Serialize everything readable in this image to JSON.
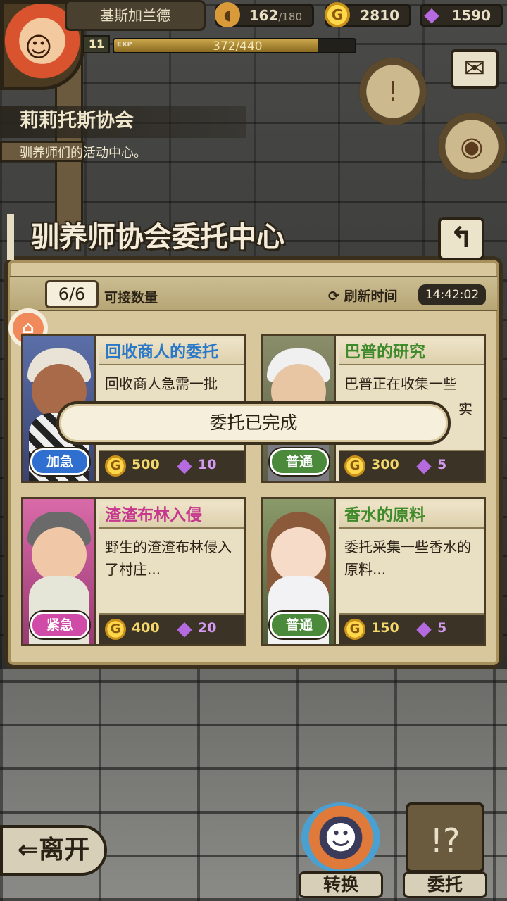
{
  "hud": {
    "player_name": "基斯加兰德",
    "level": "11",
    "exp_label": "EXP",
    "exp_text": "372/440",
    "exp_fraction": 0.845,
    "stamina_current": "162",
    "stamina_max": "/180",
    "gold": "2810",
    "gems": "1590"
  },
  "location": {
    "title": "莉莉托斯协会",
    "subtitle": "驯养师们的活动中心。"
  },
  "panel": {
    "title": "驯养师协会委托中心",
    "count": "6/6",
    "count_label": "可接数量",
    "refresh_label": "刷新时间",
    "refresh_time": "14:42:02"
  },
  "cards": [
    {
      "title": "回收商人的委托",
      "title_color": "#2a78c8",
      "desc": "回收商人急需一批",
      "tag": "加急",
      "tag_color": "#2f6fd0",
      "gold": "500",
      "gems": "10"
    },
    {
      "title": "巴普的研究",
      "title_color": "#3f8a2a",
      "desc": "巴普正在收集一些",
      "desc_extra": "实",
      "tag": "普通",
      "tag_color": "#4a8a3a",
      "gold": "300",
      "gems": "5"
    },
    {
      "title": "渣渣布林入侵",
      "title_color": "#c6378e",
      "desc": "野生的渣渣布林侵入了村庄...",
      "tag": "紧急",
      "tag_color": "#d04aa8",
      "gold": "400",
      "gems": "20"
    },
    {
      "title": "香水的原料",
      "title_color": "#3f8a2a",
      "desc": "委托采集一些香水的原料...",
      "tag": "普通",
      "tag_color": "#4a8a3a",
      "gold": "150",
      "gems": "5"
    }
  ],
  "toast": "委托已完成",
  "buttons": {
    "leave": "离开",
    "exchange": "转换",
    "commission": "委托"
  },
  "icons": {
    "stamina": "bread-icon",
    "gold": "coin-icon",
    "gems": "gem-icon",
    "mail": "envelope-icon",
    "back": "return-arrow-icon"
  }
}
